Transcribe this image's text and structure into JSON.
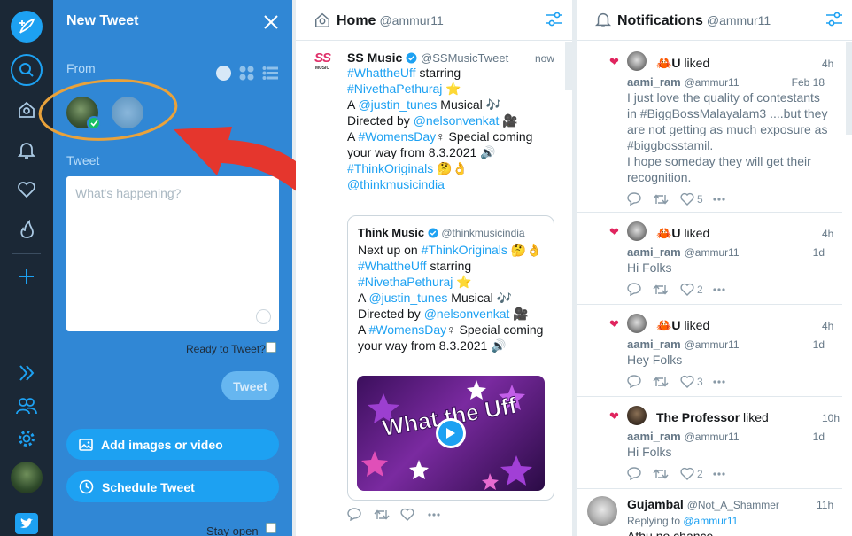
{
  "compose": {
    "title": "New Tweet",
    "from_label": "From",
    "tweet_label": "Tweet",
    "placeholder": "What's happening?",
    "ready_label": "Ready to Tweet?",
    "tweet_button": "Tweet",
    "add_media": "Add images or video",
    "schedule": "Schedule Tweet",
    "stay_open": "Stay open"
  },
  "columns": {
    "home": {
      "num": "1",
      "title": "Home",
      "handle": "@ammur11"
    },
    "notifications": {
      "num": "2",
      "title": "Notifications",
      "handle": "@ammur11"
    }
  },
  "home_tweet": {
    "name": "SS Music",
    "handle": "@SSMusicTweet",
    "time": "now",
    "avatar_text": "SS",
    "avatar_sub": "MUSIC",
    "lines": [
      [
        {
          "t": "#WhattheUff",
          "c": "link"
        },
        {
          "t": " starring"
        }
      ],
      [
        {
          "t": "#NivethaPethuraj",
          "c": "link"
        },
        {
          "t": " ⭐"
        }
      ],
      [
        {
          "t": "A "
        },
        {
          "t": "@justin_tunes",
          "c": "link"
        },
        {
          "t": " Musical 🎶"
        }
      ],
      [
        {
          "t": "Directed by "
        },
        {
          "t": "@nelsonvenkat",
          "c": "link"
        },
        {
          "t": " 🎥"
        }
      ],
      [
        {
          "t": " "
        }
      ],
      [
        {
          "t": "A "
        },
        {
          "t": "#WomensDay",
          "c": "link"
        },
        {
          "t": "♀ Special coming"
        }
      ],
      [
        {
          "t": "your way from 8.3.2021 🔊"
        }
      ],
      [
        {
          "t": "#ThinkOriginals",
          "c": "link"
        },
        {
          "t": " 🤔👌"
        }
      ],
      [
        {
          "t": "@thinkmusicindia",
          "c": "link"
        }
      ]
    ],
    "quote": {
      "name": "Think Music",
      "handle": "@thinkmusicindia",
      "lines": [
        [
          {
            "t": "Next up on "
          },
          {
            "t": "#ThinkOriginals",
            "c": "link"
          },
          {
            "t": " 🤔👌"
          }
        ],
        [
          {
            "t": "#WhattheUff",
            "c": "link"
          },
          {
            "t": " starring"
          }
        ],
        [
          {
            "t": "#NivethaPethuraj",
            "c": "link"
          },
          {
            "t": " ⭐"
          }
        ],
        [
          {
            "t": "A "
          },
          {
            "t": "@justin_tunes",
            "c": "link"
          },
          {
            "t": " Musical 🎶"
          }
        ],
        [
          {
            "t": "Directed by "
          },
          {
            "t": "@nelsonvenkat",
            "c": "link"
          },
          {
            "t": " 🎥"
          }
        ],
        [
          {
            "t": " "
          }
        ],
        [
          {
            "t": "A "
          },
          {
            "t": "#WomensDay",
            "c": "link"
          },
          {
            "t": "♀ Special coming"
          }
        ],
        [
          {
            "t": "your way from 8.3.2021 🔊"
          }
        ]
      ],
      "video_title": "What the Uff"
    }
  },
  "notifications": [
    {
      "liker": "🦀U",
      "verb": "liked",
      "ago": "4h",
      "user": "aami_ram",
      "handle": "@ammur11",
      "date": "Feb 18",
      "lines": [
        "I just love the quality of contestants",
        "in #BiggBossMalayalam3 ....but they",
        "are not getting as much exposure as",
        "#biggbosstamil.",
        "I hope someday they will get their",
        "recognition."
      ],
      "likes": "5"
    },
    {
      "liker": "🦀U",
      "verb": "liked",
      "ago": "4h",
      "user": "aami_ram",
      "handle": "@ammur11",
      "date": "1d",
      "lines": [
        "Hi Folks"
      ],
      "likes": "2"
    },
    {
      "liker": "🦀U",
      "verb": "liked",
      "ago": "4h",
      "user": "aami_ram",
      "handle": "@ammur11",
      "date": "1d",
      "lines": [
        "Hey Folks"
      ],
      "likes": "3"
    },
    {
      "liker": "The Professor",
      "verb": "liked",
      "ago": "10h",
      "user": "aami_ram",
      "handle": "@ammur11",
      "date": "1d",
      "lines": [
        "Hi Folks"
      ],
      "likes": "2"
    }
  ],
  "reply": {
    "name": "Gujambal",
    "handle": "@Not_A_Shammer",
    "time": "11h",
    "replying_prefix": "Replying to ",
    "replying_to": "@ammur11",
    "text": "Athu no chance"
  },
  "colors": {
    "rail": "#1b2836",
    "compose": "#3087d5",
    "accent": "#1da1f2",
    "heart": "#e0245e",
    "annotation": "#e5362d",
    "highlight": "#e9a23b"
  }
}
